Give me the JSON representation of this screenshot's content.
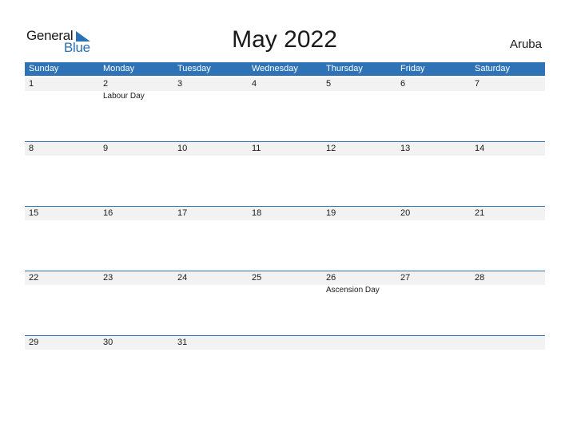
{
  "logo": {
    "line1": "General",
    "line2": "Blue"
  },
  "title": "May 2022",
  "country": "Aruba",
  "colors": {
    "accent": "#2e73b5",
    "band": "#f2f2f2"
  },
  "weekdays": [
    "Sunday",
    "Monday",
    "Tuesday",
    "Wednesday",
    "Thursday",
    "Friday",
    "Saturday"
  ],
  "weeks": [
    [
      {
        "day": "1",
        "holiday": ""
      },
      {
        "day": "2",
        "holiday": "Labour Day"
      },
      {
        "day": "3",
        "holiday": ""
      },
      {
        "day": "4",
        "holiday": ""
      },
      {
        "day": "5",
        "holiday": ""
      },
      {
        "day": "6",
        "holiday": ""
      },
      {
        "day": "7",
        "holiday": ""
      }
    ],
    [
      {
        "day": "8",
        "holiday": ""
      },
      {
        "day": "9",
        "holiday": ""
      },
      {
        "day": "10",
        "holiday": ""
      },
      {
        "day": "11",
        "holiday": ""
      },
      {
        "day": "12",
        "holiday": ""
      },
      {
        "day": "13",
        "holiday": ""
      },
      {
        "day": "14",
        "holiday": ""
      }
    ],
    [
      {
        "day": "15",
        "holiday": ""
      },
      {
        "day": "16",
        "holiday": ""
      },
      {
        "day": "17",
        "holiday": ""
      },
      {
        "day": "18",
        "holiday": ""
      },
      {
        "day": "19",
        "holiday": ""
      },
      {
        "day": "20",
        "holiday": ""
      },
      {
        "day": "21",
        "holiday": ""
      }
    ],
    [
      {
        "day": "22",
        "holiday": ""
      },
      {
        "day": "23",
        "holiday": ""
      },
      {
        "day": "24",
        "holiday": ""
      },
      {
        "day": "25",
        "holiday": ""
      },
      {
        "day": "26",
        "holiday": "Ascension Day"
      },
      {
        "day": "27",
        "holiday": ""
      },
      {
        "day": "28",
        "holiday": ""
      }
    ],
    [
      {
        "day": "29",
        "holiday": ""
      },
      {
        "day": "30",
        "holiday": ""
      },
      {
        "day": "31",
        "holiday": ""
      },
      {
        "day": "",
        "holiday": ""
      },
      {
        "day": "",
        "holiday": ""
      },
      {
        "day": "",
        "holiday": ""
      },
      {
        "day": "",
        "holiday": ""
      }
    ]
  ]
}
